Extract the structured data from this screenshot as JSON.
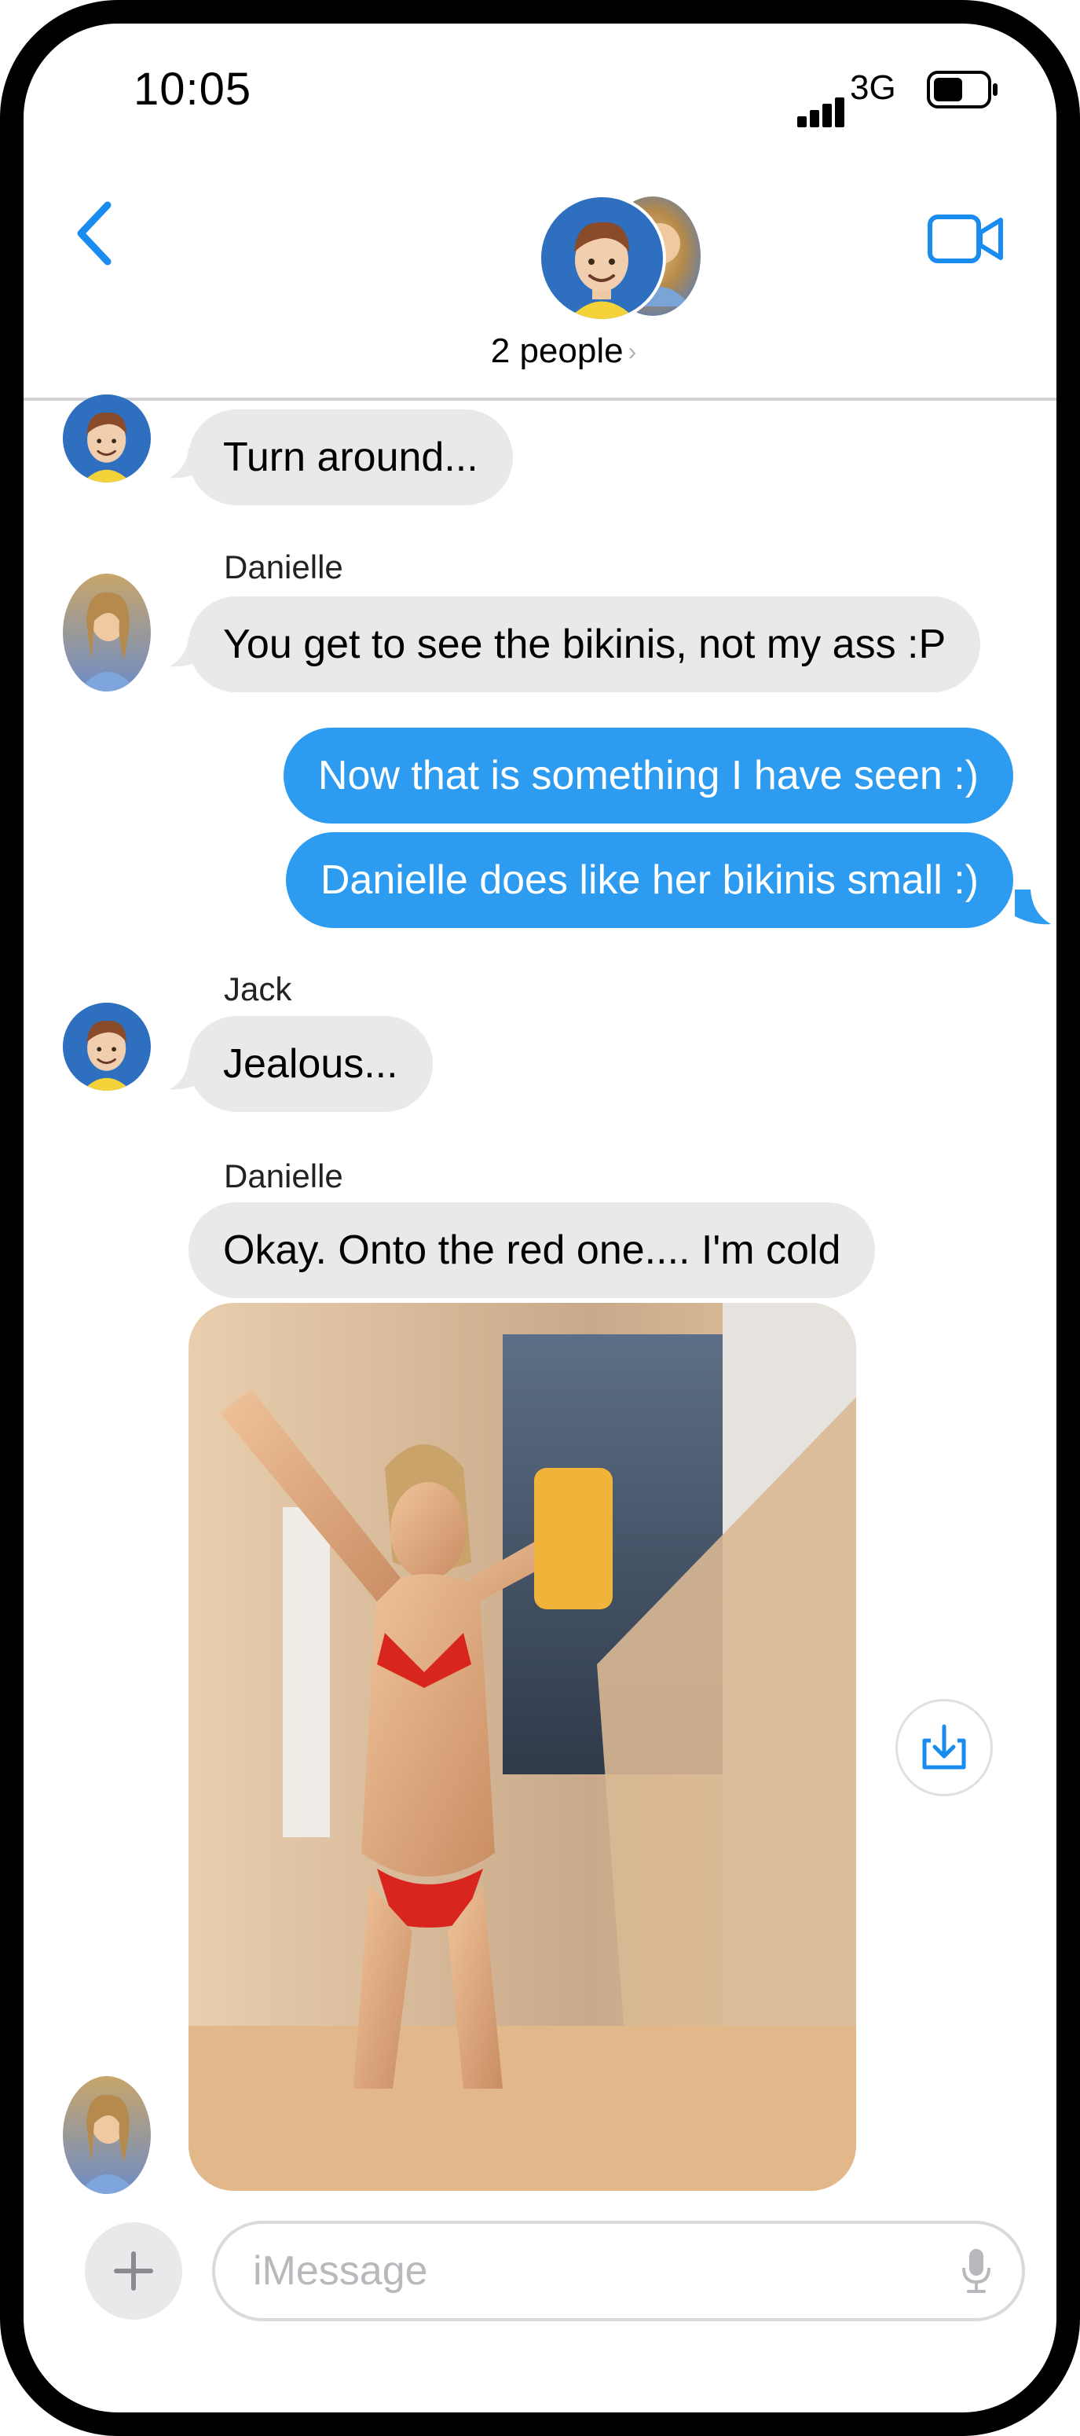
{
  "status_bar": {
    "time": "10:05",
    "network": "3G"
  },
  "header": {
    "people_label": "2 people",
    "chevron": "›"
  },
  "messages": [
    {
      "text": "Turn around..."
    },
    {
      "sender": "Danielle",
      "text": "You get to see the bikinis, not my ass :P"
    },
    {
      "text": "Now that is something I have seen :)"
    },
    {
      "text": "Danielle does like her bikinis small :)"
    },
    {
      "sender": "Jack",
      "text": "Jealous..."
    },
    {
      "sender": "Danielle",
      "text": "Okay.  Onto the red one.... I'm cold"
    }
  ],
  "composer": {
    "placeholder": "iMessage",
    "plus": "+"
  },
  "icons": {
    "back": "chevron-left-icon",
    "video": "video-camera-icon",
    "save": "download-icon",
    "mic": "microphone-icon",
    "plus": "plus-icon"
  },
  "colors": {
    "accent": "#2d9cf0",
    "incoming": "#e9e9eb",
    "outgoing": "#2d9cf0"
  }
}
